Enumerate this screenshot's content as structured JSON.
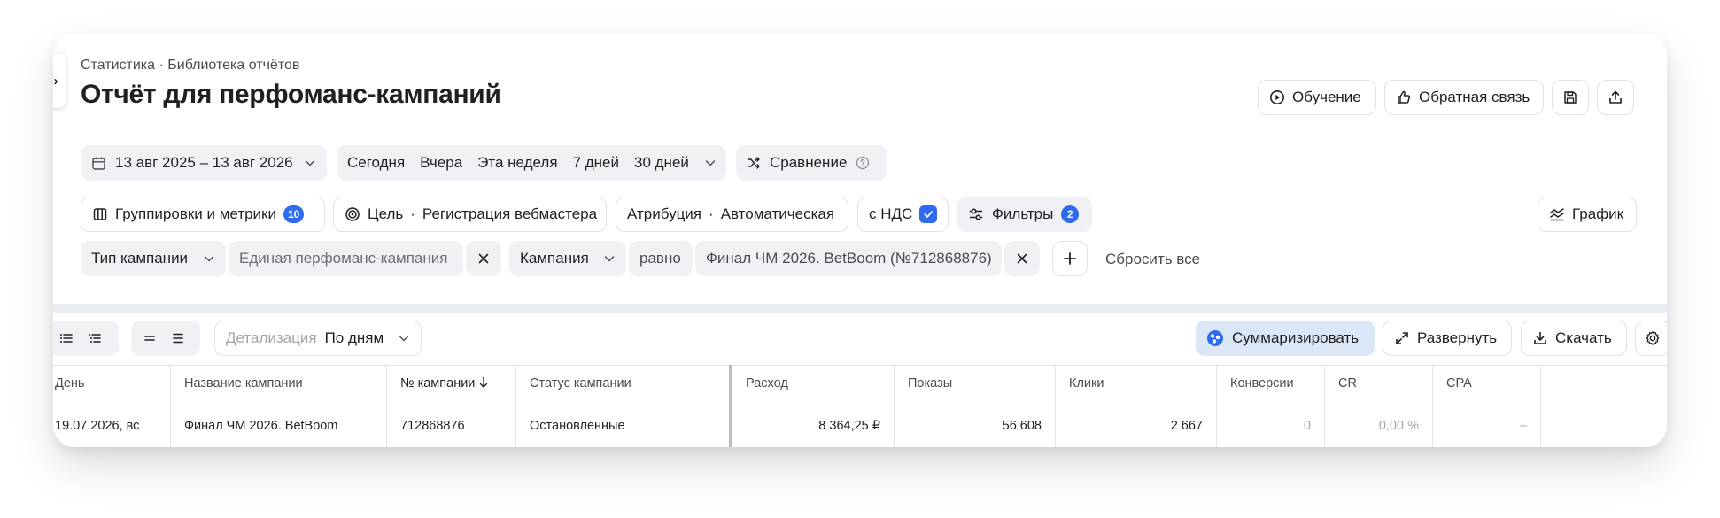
{
  "breadcrumb": {
    "item1": "Статистика",
    "separator": "·",
    "item2": "Библиотека отчётов"
  },
  "page_title": "Отчёт для перфоманс-кампаний",
  "header_actions": {
    "learning_label": "Обучение",
    "feedback_label": "Обратная связь"
  },
  "date_range": {
    "label": "13 авг 2025 – 13 авг 2026"
  },
  "periods": [
    "Сегодня",
    "Вчера",
    "Эта неделя",
    "7 дней",
    "30 дней"
  ],
  "comparison": {
    "label": "Сравнение"
  },
  "filters_row": {
    "groupings_label": "Группировки и метрики",
    "groupings_count": "10",
    "goal_label": "Цель",
    "goal_value": "Регистрация вебмастера",
    "attribution_label": "Атрибуция",
    "attribution_value": "Автоматическая",
    "vat_label": "с НДС",
    "vat_checked": true,
    "filters_label": "Фильтры",
    "filters_count": "2",
    "chart_label": "График"
  },
  "active_filters": [
    {
      "field": "Тип кампании",
      "value": "Единая перфоманс-кампания"
    },
    {
      "field": "Кампания",
      "operator": "равно",
      "value": "Финал ЧМ 2026. BetBoom (№712868876)"
    }
  ],
  "reset_all_label": "Сбросить все",
  "table_toolbar": {
    "detail_label": "Детализация",
    "detail_value": "По дням",
    "summarize_label": "Суммаризировать",
    "expand_label": "Развернуть",
    "download_label": "Скачать"
  },
  "table": {
    "columns": [
      "День",
      "Название кампании",
      "№ кампании",
      "Статус кампании",
      "Расход",
      "Показы",
      "Клики",
      "Конверсии",
      "CR",
      "CPA"
    ],
    "rows": [
      [
        "19.07.2026, вс",
        "Финал ЧМ 2026. BetBoom",
        "712868876",
        "Остановленные",
        "8 364,25 ₽",
        "56 608",
        "2 667",
        "0",
        "0,00 %",
        "–"
      ]
    ]
  },
  "colors": {
    "accent": "#2e6bf0",
    "pill_bg": "#f0f1f4",
    "summarize_bg": "#dbe6f6",
    "band": "#e9ecf3"
  },
  "icons": [
    "chevron-right-icon",
    "play-icon",
    "thumbs-up-icon",
    "save-icon",
    "share-icon",
    "calendar-icon",
    "chevron-down-icon",
    "shuffle-icon",
    "help-icon",
    "columns-icon",
    "target-icon",
    "check-icon",
    "sliders-icon",
    "chart-icon",
    "close-icon",
    "plus-icon",
    "list-icon",
    "sort-down-icon",
    "summarize-icon",
    "expand-icon",
    "download-icon",
    "gear-icon"
  ]
}
